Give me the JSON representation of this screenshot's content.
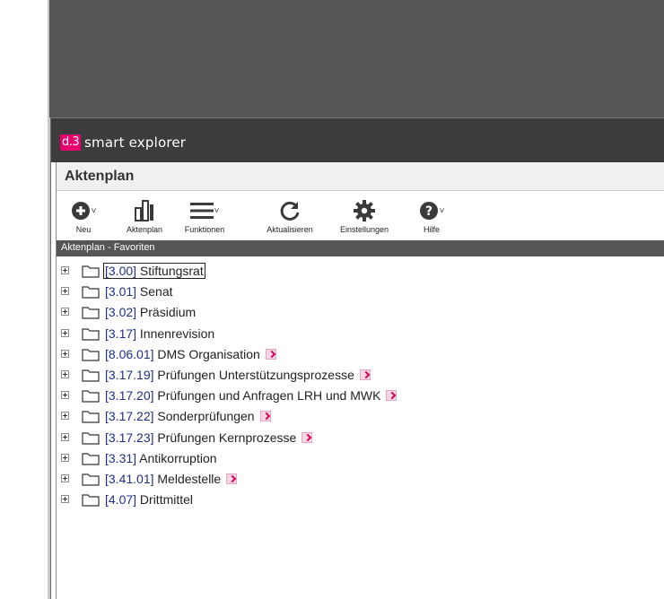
{
  "window": {
    "logo_text": "d.3",
    "app_name": "smart explorer"
  },
  "panel": {
    "title": "Aktenplan"
  },
  "toolbar": {
    "items": [
      {
        "label": "Neu",
        "icon": "plus-circle-icon",
        "has_dropdown": true
      },
      {
        "label": "Aktenplan",
        "icon": "aktenplan-icon",
        "has_dropdown": false
      },
      {
        "label": "Funktionen",
        "icon": "hamburger-menu-icon",
        "has_dropdown": true
      },
      {
        "label": "Aktualisieren",
        "icon": "refresh-icon",
        "has_dropdown": false
      },
      {
        "label": "Einstellungen",
        "icon": "gear-icon",
        "has_dropdown": false
      },
      {
        "label": "Hilfe",
        "icon": "help-circle-icon",
        "has_dropdown": true
      }
    ]
  },
  "section": {
    "title": "Aktenplan - Favoriten"
  },
  "tree": {
    "items": [
      {
        "code": "[3.00]",
        "name": "Stiftungsrat",
        "link": false,
        "selected": true
      },
      {
        "code": "[3.01]",
        "name": "Senat",
        "link": false
      },
      {
        "code": "[3.02]",
        "name": "Präsidium",
        "link": false
      },
      {
        "code": "[3.17]",
        "name": "Innenrevision",
        "link": false
      },
      {
        "code": "[8.06.01]",
        "name": "DMS Organisation",
        "link": true
      },
      {
        "code": "[3.17.19]",
        "name": "Prüfungen Unterstützungsprozesse",
        "link": true
      },
      {
        "code": "[3.17.20]",
        "name": "Prüfungen und Anfragen LRH und MWK",
        "link": true
      },
      {
        "code": "[3.17.22]",
        "name": "Sonderprüfungen",
        "link": true
      },
      {
        "code": "[3.17.23]",
        "name": "Prüfungen Kernprozesse",
        "link": true
      },
      {
        "code": "[3.31]",
        "name": "Antikorruption",
        "link": false
      },
      {
        "code": "[3.41.01]",
        "name": "Meldestelle",
        "link": true
      },
      {
        "code": "[4.07]",
        "name": "Drittmittel",
        "link": false
      }
    ]
  },
  "colors": {
    "accent": "#e5006d",
    "titlebar": "#3c3c3c",
    "section_bar": "#555555",
    "code_text": "#1f2f8a"
  }
}
